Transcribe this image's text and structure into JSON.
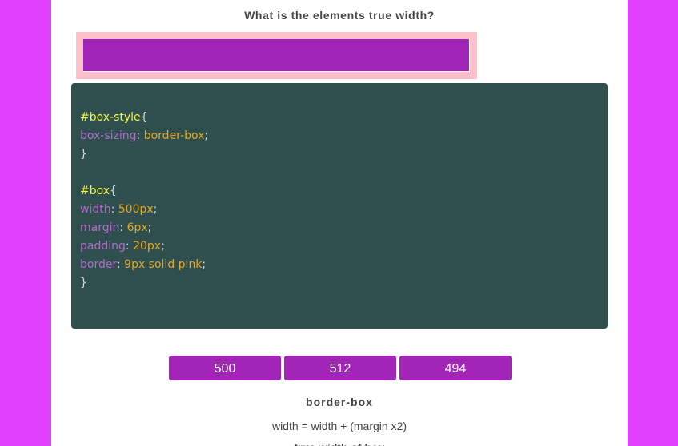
{
  "question": "What is the elements true width?",
  "code": {
    "rule1": {
      "selector": "#box-style",
      "open": "{",
      "property": "box-sizing",
      "value": "border-box",
      "close": "}"
    },
    "rule2": {
      "selector": "#box",
      "open": "{",
      "declarations": [
        {
          "property": "width",
          "value": "500px"
        },
        {
          "property": "margin",
          "value": "6px"
        },
        {
          "property": "padding",
          "value": "20px"
        },
        {
          "property": "border",
          "value": "9px solid pink"
        }
      ],
      "close": "}"
    }
  },
  "answers": [
    "500",
    "512",
    "494"
  ],
  "explanation": {
    "title": "border-box",
    "formula": "width = width + (margin x2)",
    "cut_line": "true width of box"
  },
  "colors": {
    "background": "#e040fb",
    "accent": "#a225b8",
    "code_bg": "#2f4f4f",
    "border": "pink"
  }
}
